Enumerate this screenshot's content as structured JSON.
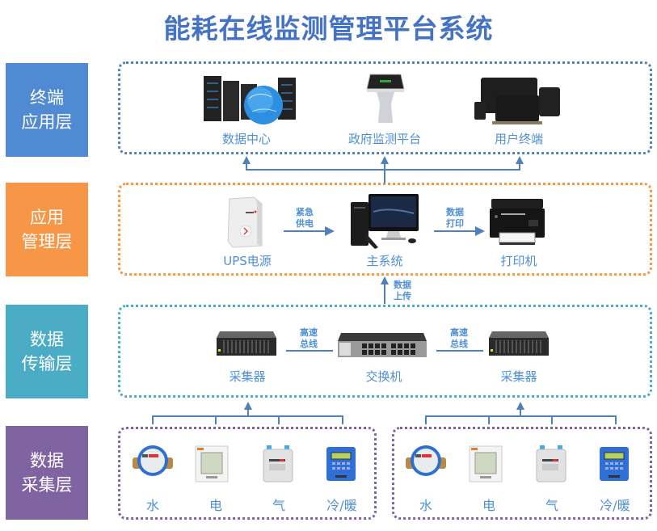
{
  "title": "能耗在线监测管理平台系统",
  "colors": {
    "title": "#4472c4",
    "terminal_layer": "#4f8ad2",
    "app_mgmt_layer": "#f79646",
    "transport_layer": "#4bacc6",
    "collect_layer": "#8064a2",
    "connector": "#4f81bd",
    "label_text": "#4f8fd6"
  },
  "layers": [
    {
      "id": "terminal",
      "line1": "终端",
      "line2": "应用层"
    },
    {
      "id": "app_mgmt",
      "line1": "应用",
      "line2": "管理层"
    },
    {
      "id": "transport",
      "line1": "数据",
      "line2": "传输层"
    },
    {
      "id": "collect",
      "line1": "数据",
      "line2": "采集层"
    }
  ],
  "terminal": {
    "items": [
      {
        "label": "数据中心",
        "icon": "server-globe-icon"
      },
      {
        "label": "政府监测平台",
        "icon": "kiosk-icon"
      },
      {
        "label": "用户终端",
        "icon": "devices-icon"
      }
    ]
  },
  "app_mgmt": {
    "items": [
      {
        "label": "UPS电源",
        "icon": "ups-icon"
      },
      {
        "label": "主系统",
        "icon": "desktop-computer-icon"
      },
      {
        "label": "打印机",
        "icon": "printer-icon"
      }
    ],
    "edge_ups": {
      "line1": "紧急",
      "line2": "供电"
    },
    "edge_print": {
      "line1": "数据",
      "line2": "打印"
    },
    "edge_upload": {
      "line1": "数据",
      "line2": "上传"
    }
  },
  "transport": {
    "items": [
      {
        "label": "采集器",
        "icon": "collector-icon"
      },
      {
        "label": "交换机",
        "icon": "switch-icon"
      },
      {
        "label": "采集器",
        "icon": "collector-icon"
      }
    ],
    "edge_left": {
      "line1": "高速",
      "line2": "总线"
    },
    "edge_right": {
      "line1": "高速",
      "line2": "总线"
    }
  },
  "collect": {
    "groups": [
      {
        "items": [
          {
            "label": "水",
            "icon": "water-meter-icon"
          },
          {
            "label": "电",
            "icon": "power-meter-icon"
          },
          {
            "label": "气",
            "icon": "gas-meter-icon"
          },
          {
            "label": "冷/暖",
            "icon": "heat-meter-icon"
          }
        ]
      },
      {
        "items": [
          {
            "label": "水",
            "icon": "water-meter-icon"
          },
          {
            "label": "电",
            "icon": "power-meter-icon"
          },
          {
            "label": "气",
            "icon": "gas-meter-icon"
          },
          {
            "label": "冷/暖",
            "icon": "heat-meter-icon"
          }
        ]
      }
    ]
  }
}
